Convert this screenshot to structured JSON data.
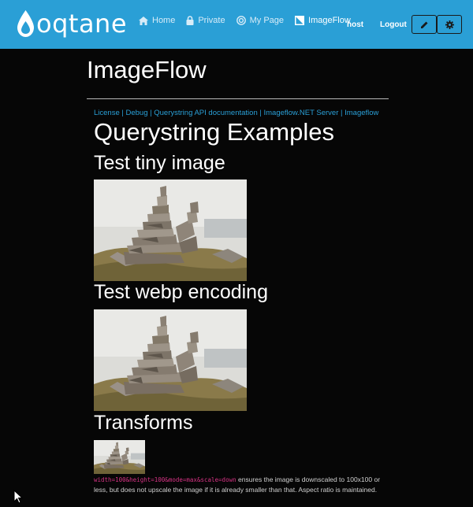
{
  "header": {
    "logo_text": "oqtane",
    "nav": [
      {
        "label": "Home",
        "icon": "home-icon"
      },
      {
        "label": "Private",
        "icon": "lock-icon"
      },
      {
        "label": "My Page",
        "icon": "target-icon"
      },
      {
        "label": "ImageFlow",
        "icon": "image-icon"
      }
    ],
    "user": "host",
    "logout_label": "Logout",
    "edit_icon": "pencil-icon",
    "settings_icon": "gear-icon"
  },
  "page": {
    "title": "ImageFlow",
    "links": [
      "License",
      "Debug",
      "Querystring API documentation",
      "Imageflow.NET Server",
      "Imageflow"
    ],
    "link_separator": "|",
    "heading": "Querystring Examples",
    "sections": [
      {
        "title": "Test tiny image"
      },
      {
        "title": "Test webp encoding"
      },
      {
        "title": "Transforms"
      }
    ],
    "transform_code": "width=100&height=100&mode=max&scale=down",
    "transform_text": "ensures the image is downscaled to 100x100 or less, but does not upscale the image if it is already smaller than that. Aspect ratio is maintained."
  },
  "colors": {
    "header_bg": "#2a9fd6",
    "page_bg": "#060606",
    "link": "#2a9fd6",
    "code": "#d63384"
  }
}
